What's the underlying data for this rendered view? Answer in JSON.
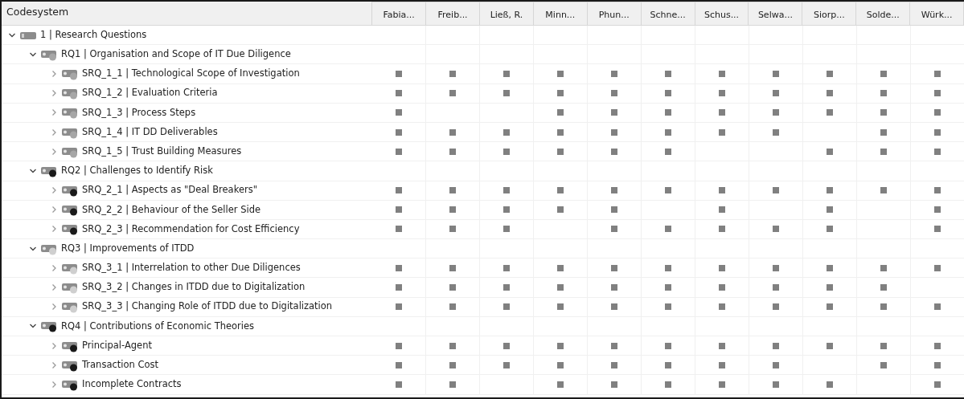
{
  "header": {
    "title": "Codesystem",
    "columns": [
      "Fabia...",
      "Freib...",
      "Ließ, R.",
      "Minn...",
      "Phun...",
      "Schne...",
      "Schus...",
      "Selwa...",
      "Siorp...",
      "Solde...",
      "Würk..."
    ]
  },
  "codes": [
    {
      "label": "1 | Research Questions",
      "kind": "folder",
      "expanded": true,
      "children": [
        {
          "label": "RQ1 | Organisation and Scope of IT Due Diligence",
          "kind": "code",
          "color": "#a6a6a6",
          "expanded": true,
          "children": [
            {
              "label": "SRQ_1_1 | Technological Scope of Investigation",
              "kind": "code",
              "color": "#a6a6a6",
              "expanded": false,
              "cells": [
                true,
                true,
                true,
                true,
                true,
                true,
                true,
                true,
                true,
                true,
                true
              ]
            },
            {
              "label": "SRQ_1_2 | Evaluation Criteria",
              "kind": "code",
              "color": "#a6a6a6",
              "expanded": false,
              "cells": [
                true,
                true,
                true,
                true,
                true,
                true,
                true,
                true,
                true,
                true,
                true
              ]
            },
            {
              "label": "SRQ_1_3 | Process Steps",
              "kind": "code",
              "color": "#a6a6a6",
              "expanded": false,
              "cells": [
                true,
                false,
                false,
                true,
                true,
                true,
                true,
                true,
                true,
                true,
                true
              ]
            },
            {
              "label": "SRQ_1_4 | IT DD Deliverables",
              "kind": "code",
              "color": "#a6a6a6",
              "expanded": false,
              "cells": [
                true,
                true,
                true,
                true,
                true,
                true,
                true,
                true,
                false,
                true,
                true
              ]
            },
            {
              "label": "SRQ_1_5 | Trust Building Measures",
              "kind": "code",
              "color": "#a6a6a6",
              "expanded": false,
              "cells": [
                true,
                true,
                true,
                true,
                true,
                true,
                false,
                false,
                true,
                true,
                true
              ]
            }
          ]
        },
        {
          "label": "RQ2 | Challenges to Identify Risk",
          "kind": "code",
          "color": "#1a1a1a",
          "expanded": true,
          "children": [
            {
              "label": "SRQ_2_1 | Aspects as \"Deal Breakers\"",
              "kind": "code",
              "color": "#1a1a1a",
              "expanded": false,
              "cells": [
                true,
                true,
                true,
                true,
                true,
                true,
                true,
                true,
                true,
                true,
                true
              ]
            },
            {
              "label": "SRQ_2_2 | Behaviour of the Seller Side",
              "kind": "code",
              "color": "#1a1a1a",
              "expanded": false,
              "cells": [
                true,
                true,
                true,
                true,
                true,
                false,
                true,
                false,
                true,
                false,
                true
              ]
            },
            {
              "label": "SRQ_2_3 | Recommendation for Cost Efficiency",
              "kind": "code",
              "color": "#1a1a1a",
              "expanded": false,
              "cells": [
                true,
                true,
                true,
                false,
                true,
                true,
                true,
                true,
                true,
                false,
                true
              ]
            }
          ]
        },
        {
          "label": "RQ3 | Improvements of ITDD",
          "kind": "code",
          "color": "#cfcfcf",
          "expanded": true,
          "children": [
            {
              "label": "SRQ_3_1 | Interrelation to other Due Diligences",
              "kind": "code",
              "color": "#cfcfcf",
              "expanded": false,
              "cells": [
                true,
                true,
                true,
                true,
                true,
                true,
                true,
                true,
                true,
                true,
                true
              ]
            },
            {
              "label": "SRQ_3_2 | Changes in ITDD due to Digitalization",
              "kind": "code",
              "color": "#cfcfcf",
              "expanded": false,
              "cells": [
                true,
                true,
                true,
                true,
                true,
                true,
                true,
                true,
                true,
                true,
                false
              ]
            },
            {
              "label": "SRQ_3_3 | Changing Role of ITDD due to Digitalization",
              "kind": "code",
              "color": "#cfcfcf",
              "expanded": false,
              "cells": [
                true,
                true,
                true,
                true,
                true,
                true,
                true,
                true,
                true,
                true,
                true
              ]
            }
          ]
        },
        {
          "label": "RQ4 | Contributions of Economic Theories",
          "kind": "code",
          "color": "#1a1a1a",
          "expanded": true,
          "children": [
            {
              "label": "Principal-Agent",
              "kind": "code",
              "color": "#1a1a1a",
              "expanded": false,
              "cells": [
                true,
                true,
                true,
                true,
                true,
                true,
                true,
                true,
                true,
                true,
                true
              ]
            },
            {
              "label": "Transaction Cost",
              "kind": "code",
              "color": "#1a1a1a",
              "expanded": false,
              "cells": [
                true,
                true,
                true,
                true,
                true,
                true,
                true,
                true,
                false,
                true,
                true
              ]
            },
            {
              "label": "Incomplete Contracts",
              "kind": "code",
              "color": "#1a1a1a",
              "expanded": false,
              "cells": [
                true,
                true,
                false,
                true,
                true,
                true,
                true,
                true,
                true,
                false,
                true
              ]
            }
          ]
        }
      ]
    }
  ]
}
